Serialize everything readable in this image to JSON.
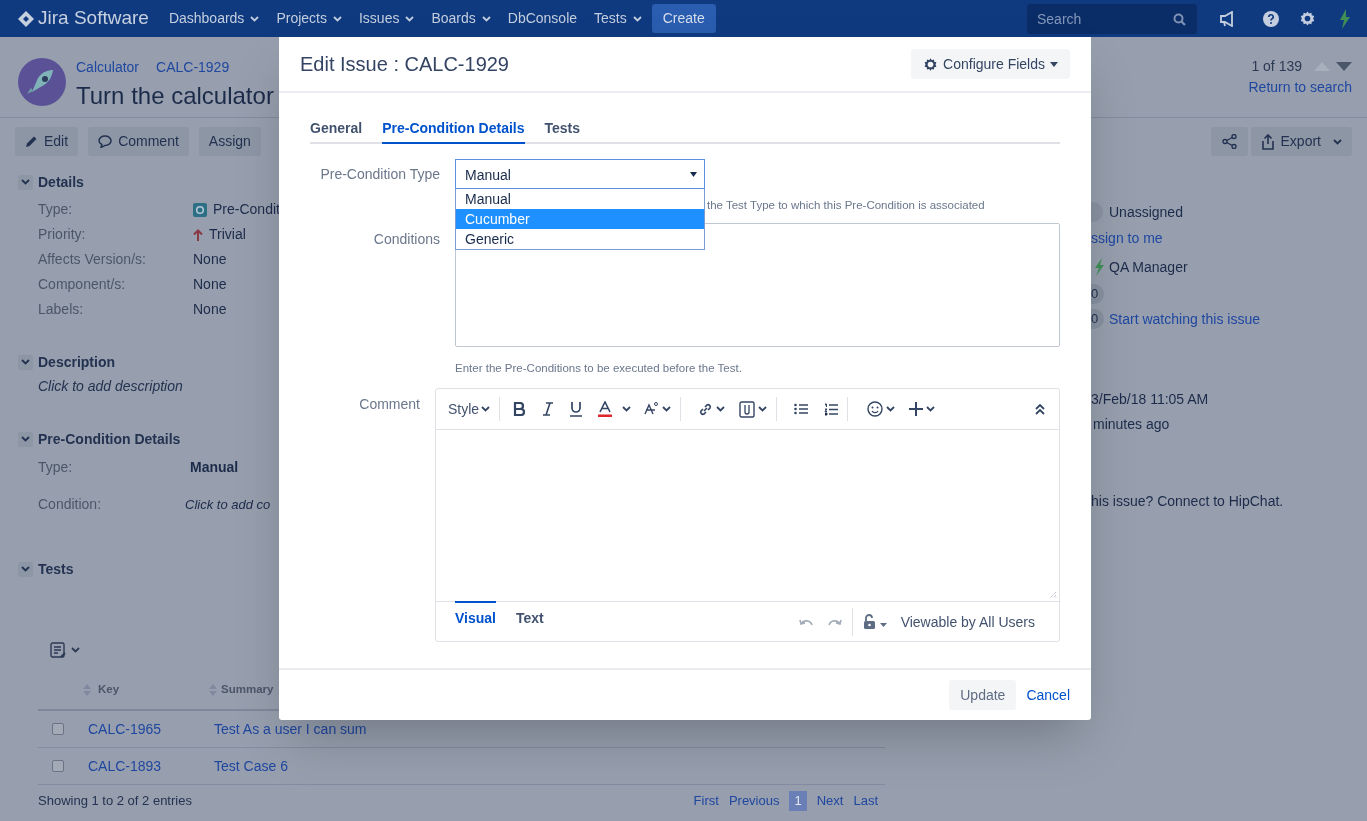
{
  "top_nav": {
    "logo": "Jira Software",
    "menus": [
      {
        "label": "Dashboards",
        "dropdown": true
      },
      {
        "label": "Projects",
        "dropdown": true
      },
      {
        "label": "Issues",
        "dropdown": true
      },
      {
        "label": "Boards",
        "dropdown": true
      },
      {
        "label": "DbConsole",
        "dropdown": false
      },
      {
        "label": "Tests",
        "dropdown": true
      }
    ],
    "create": "Create",
    "search": {
      "placeholder": "Search"
    }
  },
  "issue": {
    "breadcrumbs": [
      "Calculator",
      "CALC-1929"
    ],
    "title": "Turn the calculator",
    "pager": "1 of 139",
    "return_link": "Return to search",
    "actions": [
      "Edit",
      "Comment",
      "Assign"
    ],
    "export": "Export",
    "details": {
      "heading": "Details",
      "fields": [
        {
          "label": "Type:",
          "value": "Pre-Condit",
          "kind": "issue-type"
        },
        {
          "label": "Priority:",
          "value": "Trivial",
          "kind": "priority"
        },
        {
          "label": "Affects Version/s:",
          "value": "None",
          "kind": "text"
        },
        {
          "label": "Component/s:",
          "value": "None",
          "kind": "text"
        },
        {
          "label": "Labels:",
          "value": "None",
          "kind": "text"
        }
      ]
    },
    "description": {
      "heading": "Description",
      "text": "Click to add description"
    },
    "precondition": {
      "heading": "Pre-Condition Details",
      "type_label": "Type:",
      "type_value": "Manual",
      "condition_label": "Condition:",
      "condition_value": "Click to add co"
    },
    "tests": {
      "heading": "Tests",
      "columns": [
        "Key",
        "Summary"
      ],
      "rows": [
        {
          "checked": false,
          "key": "CALC-1965",
          "summary": "Test As a user I can sum"
        },
        {
          "checked": false,
          "key": "CALC-1893",
          "summary": "Test Case 6"
        }
      ],
      "footer": "Showing 1 to 2 of 2 entries",
      "pagination": [
        {
          "label": "First",
          "selected": false
        },
        {
          "label": "Previous",
          "selected": false
        },
        {
          "label": "1",
          "selected": true
        },
        {
          "label": "Next",
          "selected": false
        },
        {
          "label": "Last",
          "selected": false
        }
      ]
    },
    "people": {
      "assignee": "Unassigned",
      "assign_link": "ssign to me",
      "reporter": "QA Manager",
      "votes": "0",
      "watchers": "0",
      "watch_link": "Start watching this issue"
    },
    "dates": [
      "3/Feb/18 11:05 AM",
      "minutes ago"
    ],
    "hipchat": "his issue? Connect to HipChat."
  },
  "modal": {
    "title": "Edit Issue : CALC-1929",
    "configure": "Configure Fields",
    "tabs": [
      {
        "label": "General",
        "selected": false
      },
      {
        "label": "Pre-Condition Details",
        "selected": true
      },
      {
        "label": "Tests",
        "selected": false
      }
    ],
    "type_field": {
      "label": "Pre-Condition Type",
      "value": "Manual",
      "expanded": true,
      "options": [
        {
          "label": "Manual",
          "highlighted": false
        },
        {
          "label": "Cucumber",
          "highlighted": true
        },
        {
          "label": "Generic",
          "highlighted": false
        }
      ],
      "help": "the Test Type to which this Pre-Condition is associated"
    },
    "conditions": {
      "label": "Conditions",
      "help": "Enter the Pre-Conditions to be executed before the Test."
    },
    "comment": {
      "label": "Comment",
      "style_menu": "Style",
      "tabs": [
        {
          "label": "Visual",
          "selected": true
        },
        {
          "label": "Text",
          "selected": false
        }
      ],
      "visibility": "Viewable by All Users"
    },
    "buttons": {
      "update": "Update",
      "cancel": "Cancel"
    }
  }
}
